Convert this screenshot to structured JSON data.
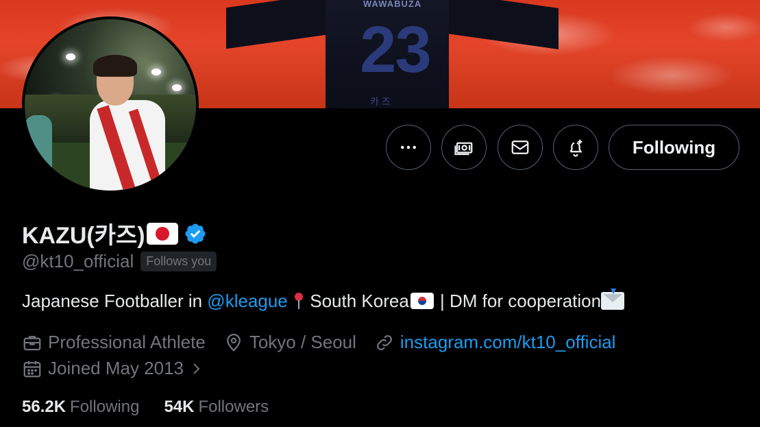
{
  "banner": {
    "jersey_name": "WAWABUZA",
    "jersey_number": "23",
    "jersey_korean": "카 즈"
  },
  "actions": {
    "more_icon": "more-horizontal-icon",
    "subscribe_icon": "money-icon",
    "message_icon": "envelope-icon",
    "notify_icon": "bell-plus-icon",
    "follow_label": "Following"
  },
  "profile": {
    "display_name": "KAZU(카즈)",
    "handle": "@kt10_official",
    "follows_you": "Follows you",
    "bio": {
      "prefix": "Japanese Footballer in ",
      "mention": "@kleague",
      "location_text": " South Korea",
      "suffix": " | DM for cooperation"
    },
    "category": "Professional Athlete",
    "location": "Tokyo / Seoul",
    "website": "instagram.com/kt10_official",
    "joined": "Joined May 2013"
  },
  "stats": {
    "following_count": "56.2K",
    "following_label": "Following",
    "followers_count": "54K",
    "followers_label": "Followers"
  },
  "colors": {
    "accent": "#1d9bf0",
    "muted": "#71767b",
    "background": "#000000",
    "text": "#e7e9ea"
  }
}
